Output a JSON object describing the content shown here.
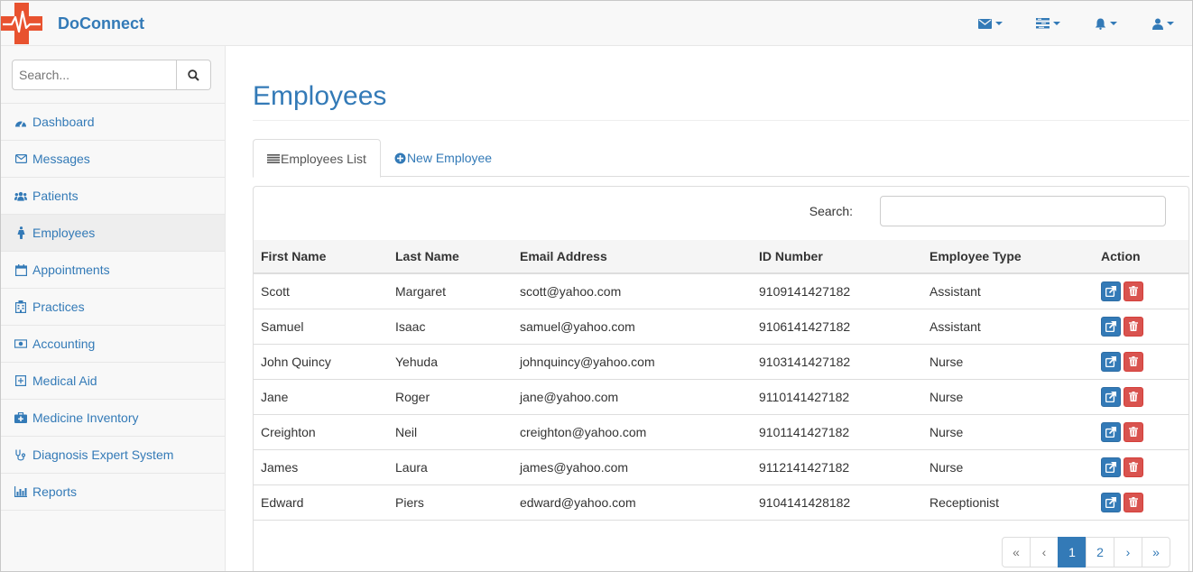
{
  "app": {
    "brand": "DoConnect"
  },
  "search": {
    "placeholder": "Search..."
  },
  "sidebar": {
    "items": [
      {
        "label": "Dashboard",
        "icon": "dashboard-icon"
      },
      {
        "label": "Messages",
        "icon": "envelope-icon"
      },
      {
        "label": "Patients",
        "icon": "users-icon"
      },
      {
        "label": "Employees",
        "icon": "person-icon"
      },
      {
        "label": "Appointments",
        "icon": "calendar-icon"
      },
      {
        "label": "Practices",
        "icon": "hospital-icon"
      },
      {
        "label": "Accounting",
        "icon": "money-icon"
      },
      {
        "label": "Medical Aid",
        "icon": "plus-square-icon"
      },
      {
        "label": "Medicine Inventory",
        "icon": "medkit-icon"
      },
      {
        "label": "Diagnosis Expert System",
        "icon": "stethoscope-icon"
      },
      {
        "label": "Reports",
        "icon": "bar-chart-icon"
      }
    ],
    "active_index": 3
  },
  "page": {
    "title": "Employees"
  },
  "tabs": [
    {
      "label": "Employees List",
      "icon": "list-icon"
    },
    {
      "label": "New Employee",
      "icon": "plus-circle-icon"
    }
  ],
  "table": {
    "search_label": "Search:",
    "columns": [
      "First Name",
      "Last Name",
      "Email Address",
      "ID Number",
      "Employee Type",
      "Action"
    ],
    "rows": [
      [
        "Scott",
        "Margaret",
        "scott@yahoo.com",
        "9109141427182",
        "Assistant"
      ],
      [
        "Samuel",
        "Isaac",
        "samuel@yahoo.com",
        "9106141427182",
        "Assistant"
      ],
      [
        "John Quincy",
        "Yehuda",
        "johnquincy@yahoo.com",
        "9103141427182",
        "Nurse"
      ],
      [
        "Jane",
        "Roger",
        "jane@yahoo.com",
        "9110141427182",
        "Nurse"
      ],
      [
        "Creighton",
        "Neil",
        "creighton@yahoo.com",
        "9101141427182",
        "Nurse"
      ],
      [
        "James",
        "Laura",
        "james@yahoo.com",
        "9112141427182",
        "Nurse"
      ],
      [
        "Edward",
        "Piers",
        "edward@yahoo.com",
        "9104141428182",
        "Receptionist"
      ]
    ]
  },
  "pagination": {
    "items": [
      "«",
      "‹",
      "1",
      "2",
      "›",
      "»"
    ],
    "active": "1"
  },
  "colors": {
    "accent": "#337ab7",
    "danger": "#d9534f",
    "logo": "#e8522f"
  }
}
